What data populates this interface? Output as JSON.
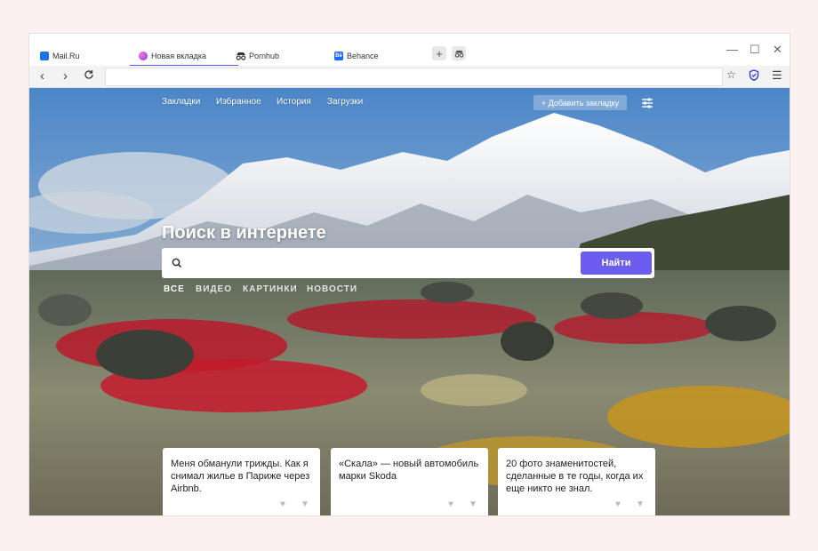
{
  "tabs": [
    {
      "label": "Mail.Ru",
      "favicon": "mailru-icon",
      "color": "#1a73e8"
    },
    {
      "label": "Новая вкладка",
      "favicon": "marusya-icon",
      "color": "#d946c8"
    },
    {
      "label": "Pornhub",
      "favicon": "incognito-icon",
      "color": "#333333"
    },
    {
      "label": "Behance",
      "favicon": "behance-icon",
      "color": "#1769ff",
      "badge": "Bē"
    }
  ],
  "newtab": {
    "links": [
      "Закладки",
      "Избранное",
      "История",
      "Загрузки"
    ],
    "add_bookmark": "+ Добавить закладку",
    "heading": "Поиск в интернете",
    "search": {
      "placeholder": "",
      "value": "",
      "button": "Найти"
    },
    "categories": [
      "ВСЕ",
      "ВИДЕО",
      "КАРТИНКИ",
      "НОВОСТИ"
    ],
    "cards": [
      {
        "text": "Меня обманули трижды. Как я снимал жилье в Париже через Airbnb."
      },
      {
        "text": "«Скала» — новый автомобиль марки Skoda"
      },
      {
        "text": "20 фото знаменитостей, сделанные в те годы, когда их еще никто не знал."
      }
    ]
  },
  "colors": {
    "accent": "#6c5cf0",
    "active_tab_line": "#5a5fe8",
    "page_bg": "#fdf0f0"
  }
}
